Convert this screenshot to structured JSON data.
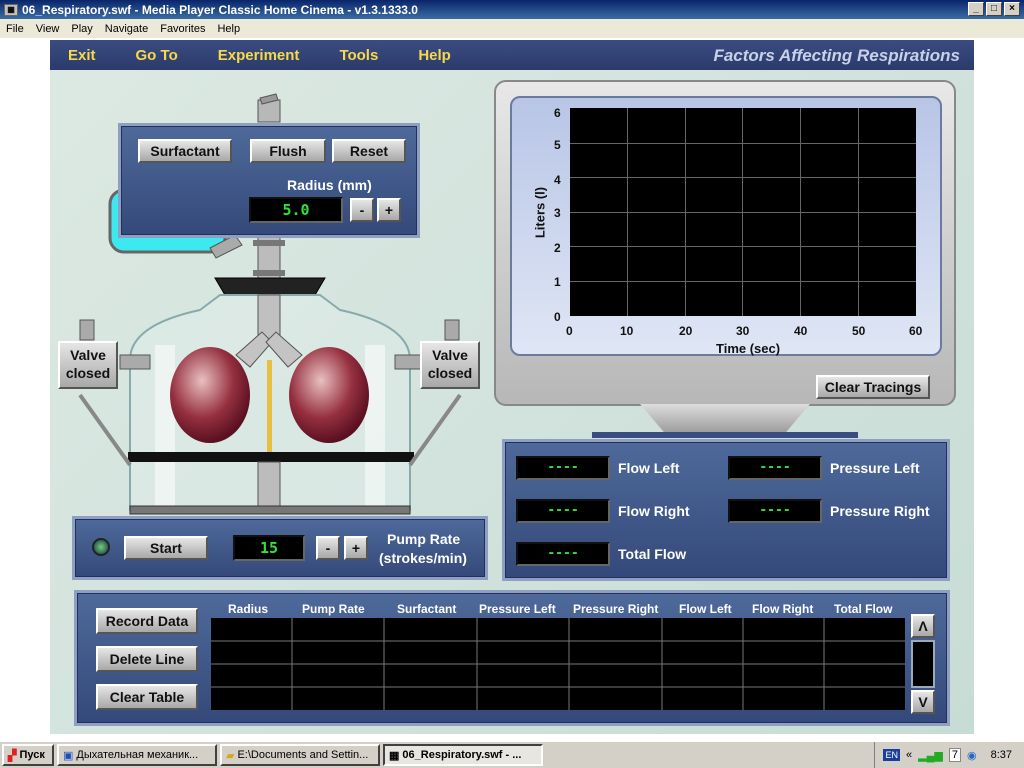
{
  "window": {
    "title": "06_Respiratory.swf - Media Player Classic Home Cinema - v1.3.1333.0",
    "min": "_",
    "max": "□",
    "close": "×"
  },
  "menu": [
    "File",
    "View",
    "Play",
    "Navigate",
    "Favorites",
    "Help"
  ],
  "app": {
    "nav": [
      "Exit",
      "Go To",
      "Experiment",
      "Tools",
      "Help"
    ],
    "title": "Factors Affecting Respirations"
  },
  "controls": {
    "surfactant": "Surfactant",
    "flush": "Flush",
    "reset": "Reset",
    "radius_label": "Radius (mm)",
    "radius_value": "5.0",
    "minus": "-",
    "plus": "+"
  },
  "valves": {
    "left": [
      "Valve",
      "closed"
    ],
    "right": [
      "Valve",
      "closed"
    ]
  },
  "pump": {
    "start": "Start",
    "rate_value": "15",
    "label1": "Pump Rate",
    "label2": "(strokes/min)"
  },
  "monitor": {
    "ylabel": "Liters (l)",
    "xlabel": "Time (sec)",
    "yticks": [
      "6",
      "5",
      "4",
      "3",
      "2",
      "1",
      "0"
    ],
    "xticks": [
      "0",
      "10",
      "20",
      "30",
      "40",
      "50",
      "60"
    ],
    "clear": "Clear Tracings"
  },
  "readouts": {
    "flow_left_label": "Flow Left",
    "flow_right_label": "Flow Right",
    "total_flow_label": "Total Flow",
    "pressure_left_label": "Pressure Left",
    "pressure_right_label": "Pressure Right",
    "placeholder": "----"
  },
  "table": {
    "headers": [
      "Radius",
      "Pump Rate",
      "Surfactant",
      "Pressure Left",
      "Pressure Right",
      "Flow Left",
      "Flow Right",
      "Total Flow"
    ],
    "record": "Record Data",
    "delete": "Delete Line",
    "clear": "Clear Table",
    "up": "Λ",
    "down": "V"
  },
  "taskbar": {
    "start": "Пуск",
    "items": [
      "Дыхательная механик...",
      "E:\\Documents and Settin...",
      "06_Respiratory.swf - ..."
    ],
    "lang": "EN",
    "clock": "8:37",
    "tray_num": "7",
    "chevron": "«"
  },
  "colors": {
    "lcd_green": "#2fe23a",
    "nav_yellow": "#f7d94a",
    "panel_blue": "#3a5286"
  }
}
